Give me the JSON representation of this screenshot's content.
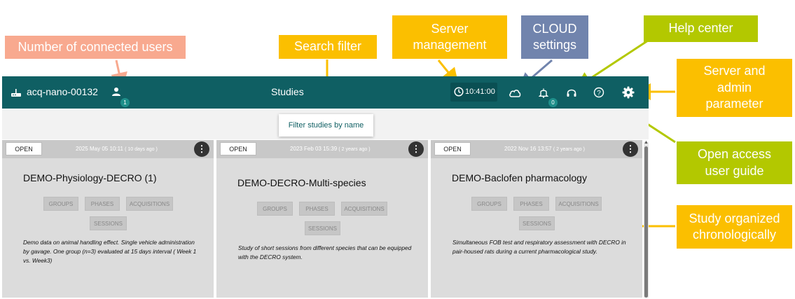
{
  "callouts": {
    "connected_users": "Number of connected users",
    "search_filter": "Search filter",
    "server_management": "Server\nmanagement",
    "cloud_settings": "CLOUD\nsettings",
    "help_center": "Help center",
    "server_admin": "Server and\nadmin\nparameter",
    "open_access": "Open access\nuser guide",
    "chronological": "Study organized\nchronologically"
  },
  "topbar": {
    "device_name": "acq-nano-00132",
    "users_count": "1",
    "page_title": "Studies",
    "server_time": "10:41:00",
    "notifications_count": "0"
  },
  "filter": {
    "label": "Filter studies by name"
  },
  "studies": [
    {
      "open_label": "OPEN",
      "date": "2025 May 05 10:11",
      "age": "( 10 days ago )",
      "title": "DEMO-Physiology-DECRO (1)",
      "chips": [
        "GROUPS",
        "PHASES",
        "ACQUISITIONS",
        "SESSIONS"
      ],
      "description": "Demo data on animal handling effect. Single vehicle administration by gavage. One group (n=3) evaluated at 15 days interval ( Week 1 vs. Week3)"
    },
    {
      "open_label": "OPEN",
      "date": "2023 Feb 03 15:39",
      "age": "( 2 years ago )",
      "title": "DEMO-DECRO-Multi-species",
      "chips": [
        "GROUPS",
        "PHASES",
        "ACQUISITIONS",
        "SESSIONS"
      ],
      "description": "Study of short sessions from different species that can be equipped with the DECRO system."
    },
    {
      "open_label": "OPEN",
      "date": "2022 Nov 16 13:57",
      "age": "( 2 years ago )",
      "title": "DEMO-Baclofen pharmacology",
      "chips": [
        "GROUPS",
        "PHASES",
        "ACQUISITIONS",
        "SESSIONS"
      ],
      "description": "Simultaneous FOB test and respiratory assessment with DECRO in pair-housed rats during a current pharmacological study."
    }
  ],
  "colors": {
    "topbar": "#0f5f63",
    "callout_salmon": "#f8a98f",
    "callout_gold": "#fbbf00",
    "callout_slate": "#7184ad",
    "callout_lime": "#b3c800",
    "card_bg": "#dcdcdc"
  },
  "icons": [
    "router-icon",
    "user-icon",
    "clock-icon",
    "cloud-icon",
    "bell-icon",
    "headset-icon",
    "help-circle-icon",
    "gear-icon",
    "more-vertical-icon"
  ]
}
